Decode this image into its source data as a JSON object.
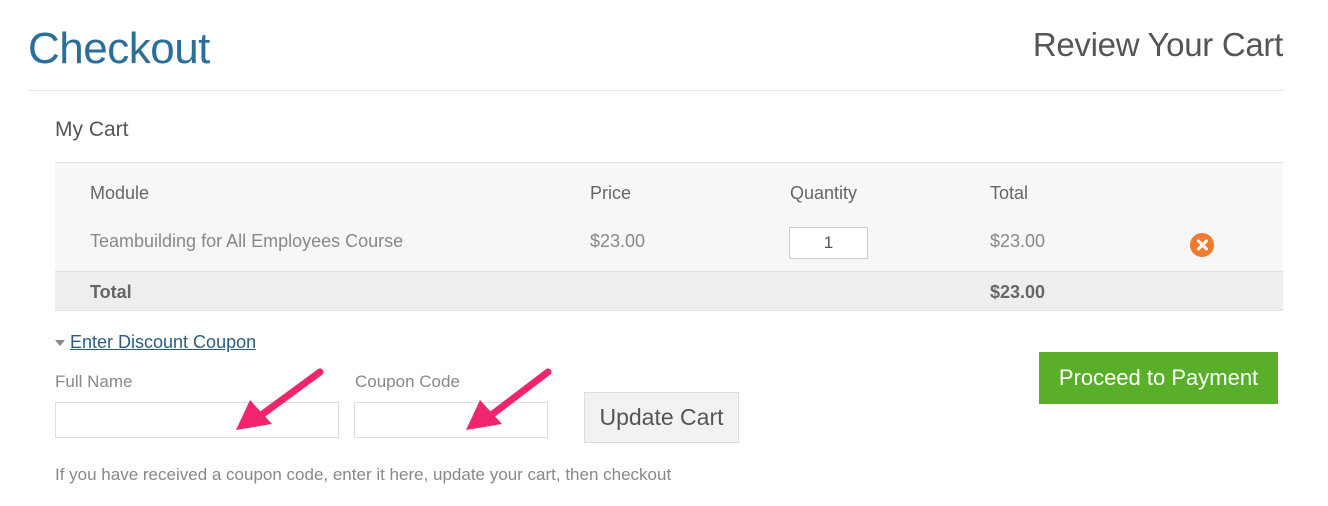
{
  "header": {
    "title": "Checkout",
    "subtitle": "Review Your Cart"
  },
  "cart": {
    "title": "My Cart",
    "columns": [
      "Module",
      "Price",
      "Quantity",
      "Total"
    ],
    "rows": [
      {
        "module": "Teambuilding for All Employees Course",
        "price": "$23.00",
        "quantity": "1",
        "total": "$23.00"
      }
    ],
    "footer": {
      "label": "Total",
      "total": "$23.00"
    }
  },
  "coupon": {
    "toggle_label": "Enter Discount Coupon",
    "full_name_label": "Full Name",
    "full_name_value": "",
    "coupon_code_label": "Coupon Code",
    "coupon_code_value": "",
    "update_button": "Update Cart",
    "help_text": "If you have received a coupon code, enter it here, update your cart, then checkout"
  },
  "actions": {
    "proceed_button": "Proceed to Payment"
  },
  "colors": {
    "title": "#2a6e9a",
    "proceed": "#5aaf2a",
    "remove": "#f07a2f",
    "annotation_arrow": "#f0256e"
  },
  "icons": [
    "remove-icon",
    "caret-down-icon",
    "annotation-arrow-icon"
  ]
}
